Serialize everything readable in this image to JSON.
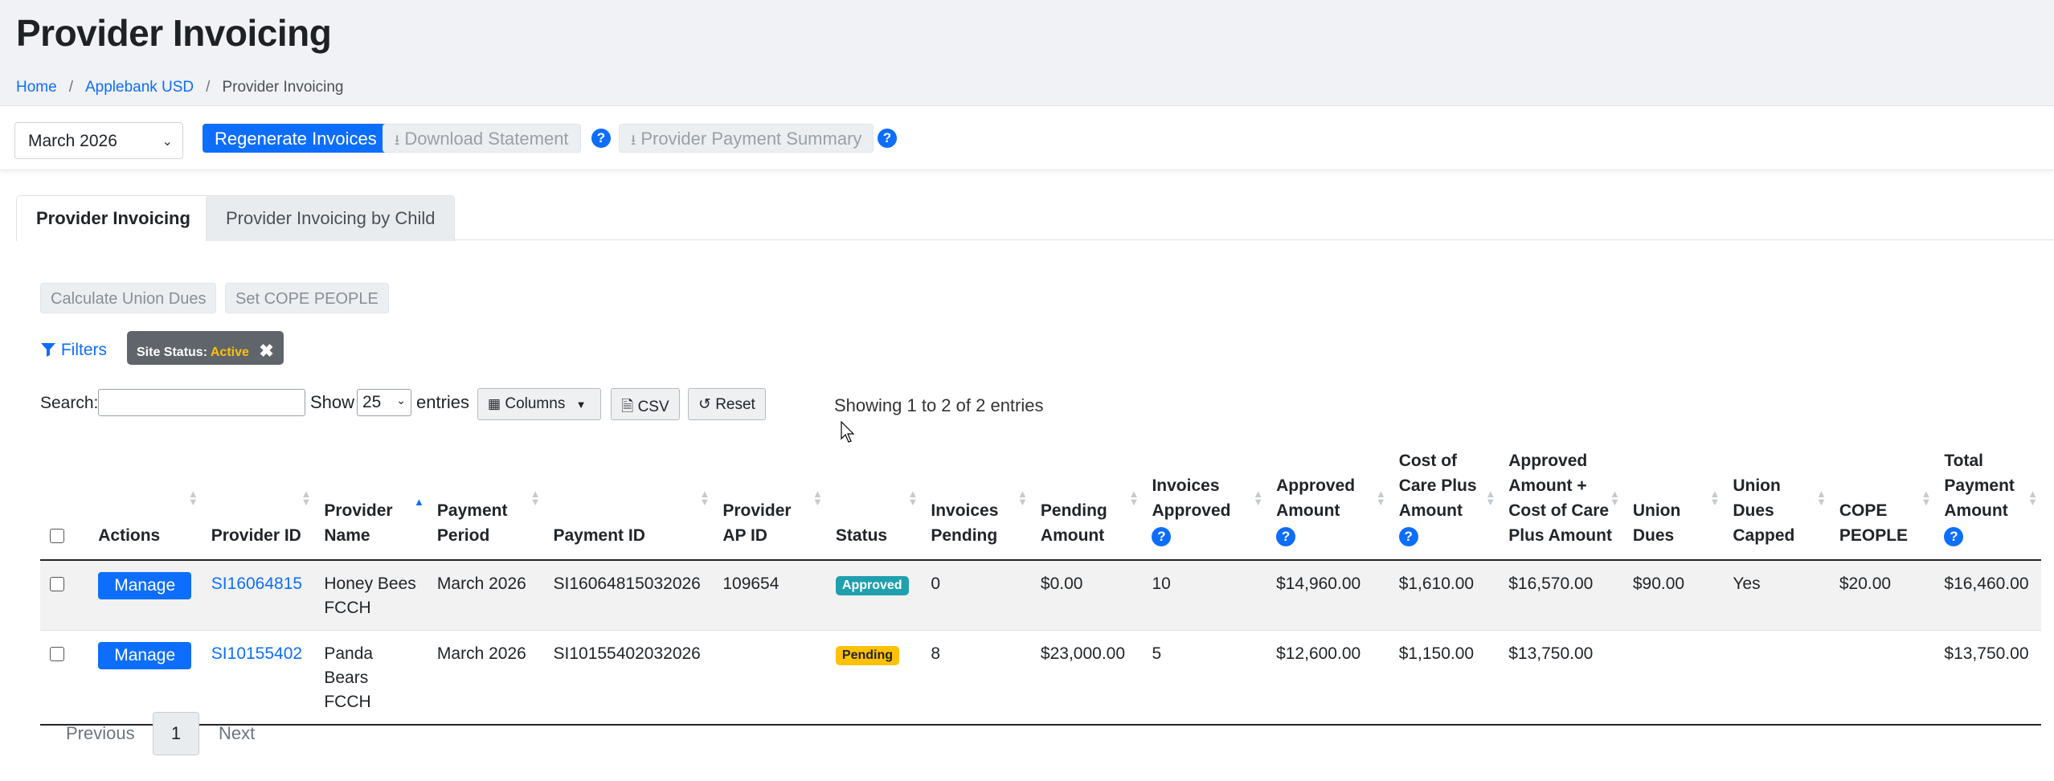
{
  "header": {
    "title": "Provider Invoicing",
    "breadcrumb": [
      "Home",
      "Applebank USD",
      "Provider Invoicing"
    ]
  },
  "toolbar": {
    "month": "March 2026",
    "regenerate": "Regenerate Invoices",
    "download_statement": "Download Statement",
    "payment_summary": "Provider Payment Summary"
  },
  "tabs": [
    "Provider Invoicing",
    "Provider Invoicing by Child"
  ],
  "actions": {
    "calc_union_dues": "Calculate Union Dues",
    "set_cope": "Set COPE PEOPLE"
  },
  "filters": {
    "label": "Filters",
    "chip_key": "Site Status:",
    "chip_value": "Active"
  },
  "table_controls": {
    "search_label": "Search:",
    "show_label": "Show",
    "page_size": "25",
    "entries_label": "entries",
    "columns_btn": "Columns",
    "csv_btn": "CSV",
    "reset_btn": "Reset",
    "showing": "Showing 1 to 2 of 2 entries"
  },
  "table": {
    "columns": [
      "Actions",
      "Provider ID",
      "Provider Name",
      "Payment Period",
      "Payment ID",
      "Provider AP ID",
      "Status",
      "Invoices Pending",
      "Pending Amount",
      "Invoices Approved",
      "Approved Amount",
      "Cost of Care Plus Amount",
      "Approved Amount + Cost of Care Plus Amount",
      "Union Dues",
      "Union Dues Capped",
      "COPE PEOPLE",
      "Total Payment Amount"
    ],
    "rows": [
      {
        "action": "Manage",
        "provider_id": "SI16064815",
        "provider_name": "Honey Bees FCCH",
        "payment_period": "March 2026",
        "payment_id": "SI16064815032026",
        "ap_id": "109654",
        "status": "Approved",
        "invoices_pending": "0",
        "pending_amount": "$0.00",
        "invoices_approved": "10",
        "approved_amount": "$14,960.00",
        "cost_of_care": "$1,610.00",
        "approved_plus_care": "$16,570.00",
        "union_dues": "$90.00",
        "dues_capped": "Yes",
        "cope_people": "$20.00",
        "total_payment": "$16,460.00"
      },
      {
        "action": "Manage",
        "provider_id": "SI10155402",
        "provider_name": "Panda Bears FCCH",
        "payment_period": "March 2026",
        "payment_id": "SI10155402032026",
        "ap_id": "",
        "status": "Pending",
        "invoices_pending": "8",
        "pending_amount": "$23,000.00",
        "invoices_approved": "5",
        "approved_amount": "$12,600.00",
        "cost_of_care": "$1,150.00",
        "approved_plus_care": "$13,750.00",
        "union_dues": "",
        "dues_capped": "",
        "cope_people": "",
        "total_payment": "$13,750.00"
      }
    ]
  },
  "pagination": {
    "previous": "Previous",
    "page": "1",
    "next": "Next"
  },
  "colors": {
    "primary": "#0d6efd",
    "approved": "#20a0ae",
    "pending": "#ffc107"
  }
}
